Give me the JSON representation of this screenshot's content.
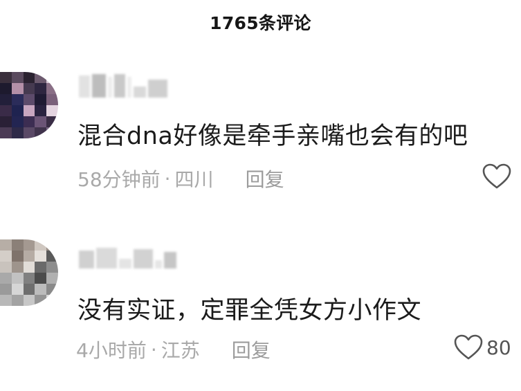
{
  "header": {
    "title": "1765条评论"
  },
  "comments": [
    {
      "username": "",
      "text": "混合dna好像是牵手亲嘴也会有的吧",
      "time": "58分钟前",
      "location": "四川",
      "reply_label": "回复",
      "like_count": "",
      "avatar_icon": "avatar-pixelated",
      "like_icon": "heart-outline-icon"
    },
    {
      "username": "",
      "text": "没有实证，定罪全凭女方小作文",
      "time": "4小时前",
      "location": "江苏",
      "reply_label": "回复",
      "like_count": "80",
      "avatar_icon": "avatar-pixelated",
      "like_icon": "heart-outline-icon"
    }
  ],
  "meta_separator": "·",
  "colors": {
    "background": "#ffffff",
    "text_primary": "#1b1b1b",
    "text_secondary": "#a9a9a9",
    "icon": "#555555"
  }
}
